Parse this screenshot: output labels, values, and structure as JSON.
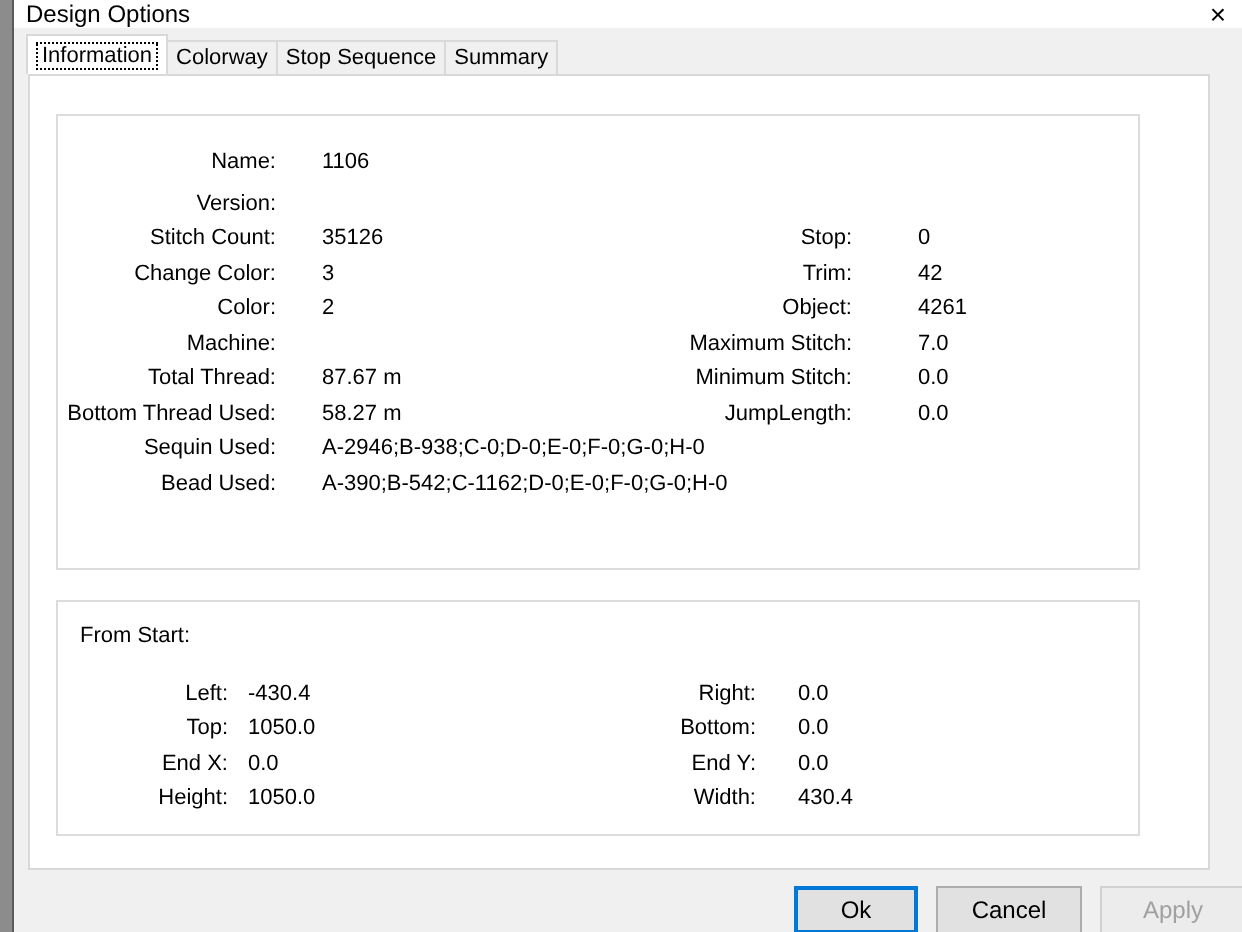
{
  "window": {
    "title": "Design Options",
    "close": "×"
  },
  "tabs": [
    {
      "label": "Information",
      "selected": true
    },
    {
      "label": "Colorway",
      "selected": false
    },
    {
      "label": "Stop Sequence",
      "selected": false
    },
    {
      "label": "Summary",
      "selected": false
    }
  ],
  "information": {
    "rows": [
      {
        "left": {
          "label": "Name:",
          "value": "1106"
        }
      },
      {
        "left": {
          "label": "Version:"
        }
      },
      {
        "left": {
          "label": "Stitch Count:",
          "value": "35126"
        },
        "right": {
          "label": "Stop:",
          "value": "0"
        }
      },
      {
        "left": {
          "label": "Change Color:",
          "value": "3"
        },
        "right": {
          "label": "Trim:",
          "value": "42"
        }
      },
      {
        "left": {
          "label": "Color:",
          "value": "2"
        },
        "right": {
          "label": "Object:",
          "value": "4261"
        }
      },
      {
        "left": {
          "label": "Machine:"
        },
        "right": {
          "label": "Maximum Stitch:",
          "value": "7.0"
        }
      },
      {
        "left": {
          "label": "Total Thread:",
          "value": "87.67 m"
        },
        "right": {
          "label": "Minimum Stitch:",
          "value": "0.0"
        }
      },
      {
        "left": {
          "label": "Bottom Thread Used:",
          "value": "58.27 m"
        },
        "right": {
          "label": "JumpLength:",
          "value": "0.0"
        }
      },
      {
        "left": {
          "label": "Sequin Used:",
          "value": "A-2946;B-938;C-0;D-0;E-0;F-0;G-0;H-0"
        }
      },
      {
        "left": {
          "label": "Bead Used:",
          "value": "A-390;B-542;C-1162;D-0;E-0;F-0;G-0;H-0"
        }
      }
    ]
  },
  "from_start": {
    "title": "From Start:",
    "rows": [
      {
        "left": {
          "label": "Left:",
          "value": "-430.4"
        },
        "right": {
          "label": "Right:",
          "value": "0.0"
        }
      },
      {
        "left": {
          "label": "Top:",
          "value": "1050.0"
        },
        "right": {
          "label": "Bottom:",
          "value": "0.0"
        }
      },
      {
        "left": {
          "label": "End X:",
          "value": "0.0"
        },
        "right": {
          "label": "End Y:",
          "value": "0.0"
        }
      },
      {
        "left": {
          "label": "Height:",
          "value": "1050.0"
        },
        "right": {
          "label": "Width:",
          "value": "430.4"
        }
      }
    ]
  },
  "buttons": [
    {
      "label": "Ok",
      "default": true,
      "disabled": false
    },
    {
      "label": "Cancel",
      "default": false,
      "disabled": false
    },
    {
      "label": "Apply",
      "default": false,
      "disabled": true
    }
  ]
}
